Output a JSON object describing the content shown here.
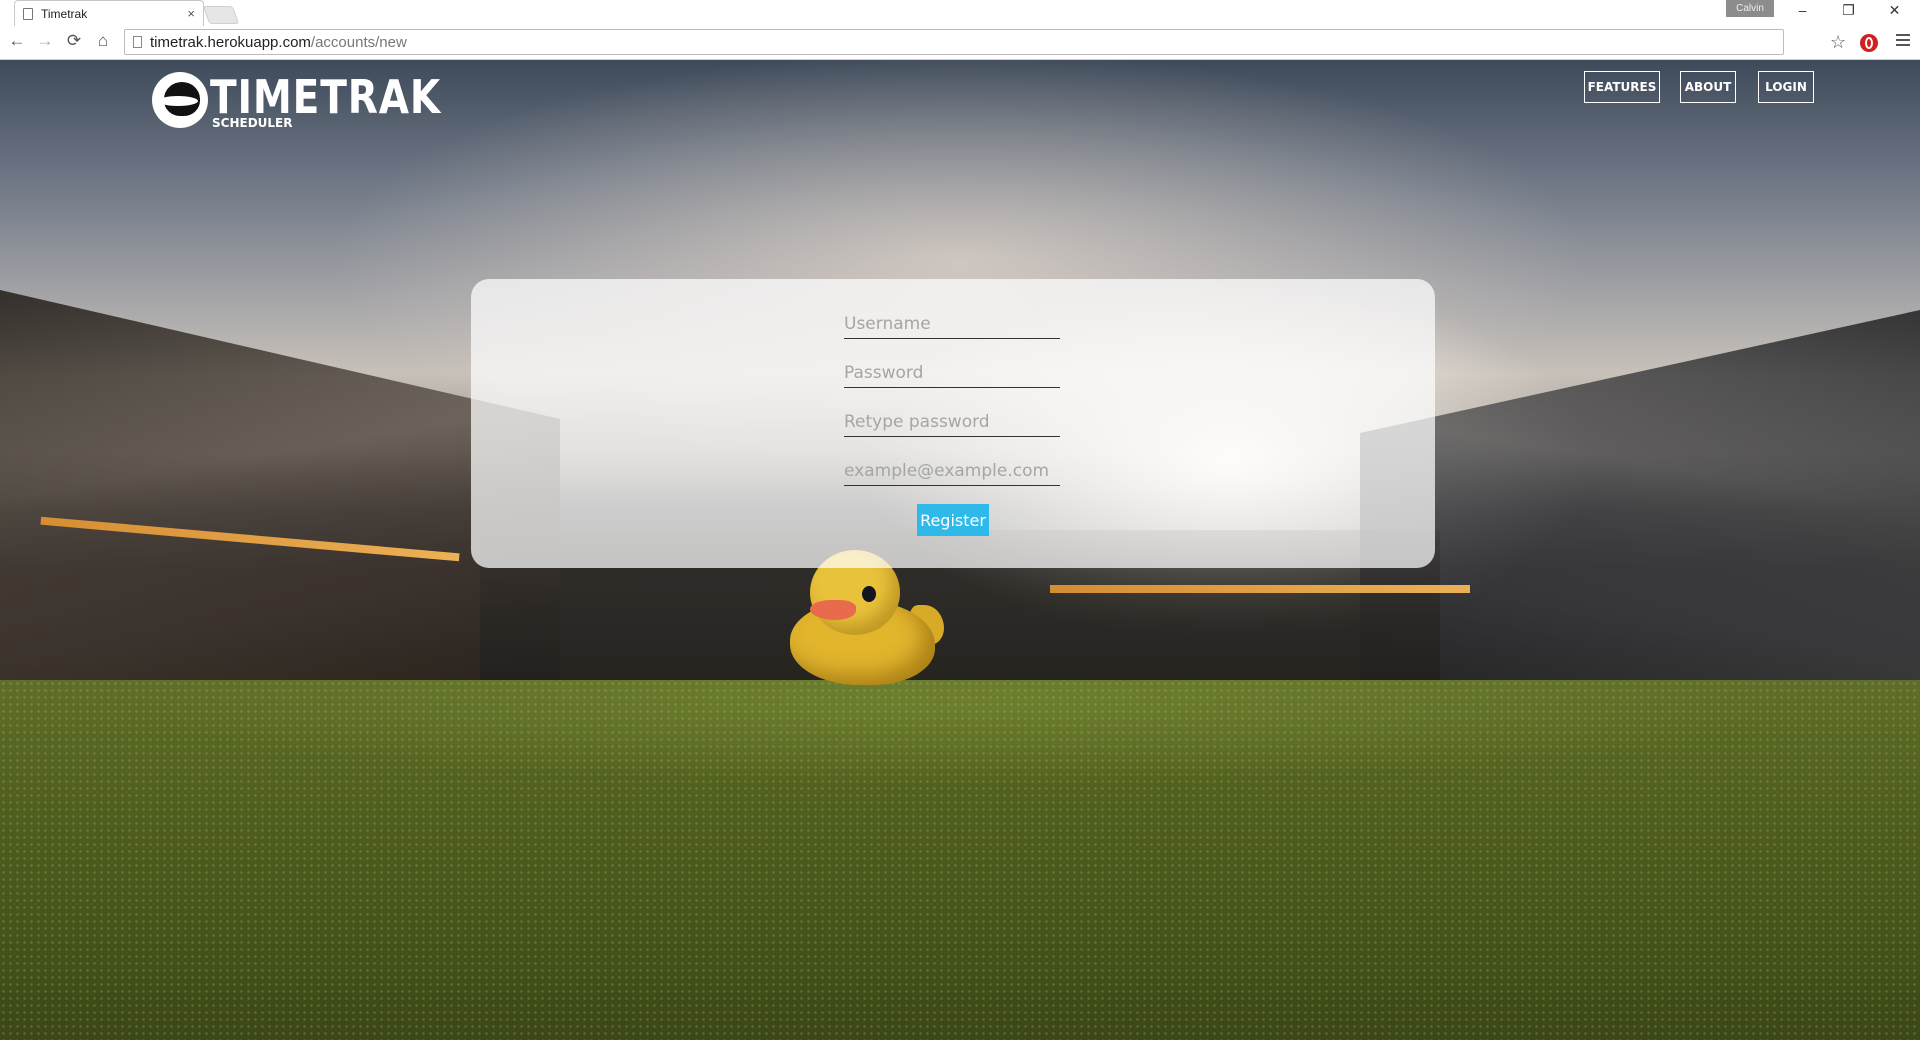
{
  "browser": {
    "tab_title": "Timetrak",
    "tab_close": "×",
    "profile_name": "Calvin",
    "window_controls": {
      "minimize": "–",
      "restore": "❐",
      "close": "✕"
    },
    "nav": {
      "back": "←",
      "forward": "→",
      "reload": "⟳",
      "home": "⌂"
    },
    "url_host": "timetrak.herokuapp.com",
    "url_path": "/accounts/new",
    "star": "☆"
  },
  "site": {
    "logo_title": "TIMETRAK",
    "logo_subtitle": "SCHEDULER",
    "nav": {
      "features": "FEATURES",
      "about": "ABOUT",
      "login": "LOGIN"
    }
  },
  "form": {
    "username_placeholder": "Username",
    "password_placeholder": "Password",
    "retype_placeholder": "Retype password",
    "email_placeholder": "example@example.com",
    "submit_label": "Register"
  },
  "colors": {
    "accent": "#2fb9e8",
    "duck": "#e2b52d"
  }
}
